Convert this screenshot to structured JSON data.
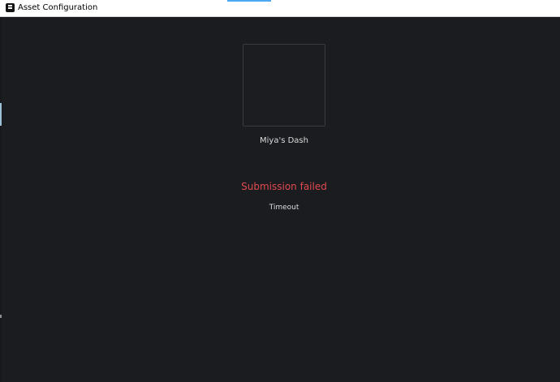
{
  "window": {
    "title": "Asset Configuration",
    "app_icon": "roblox-studio-icon"
  },
  "asset": {
    "name": "Miya's Dash",
    "thumbnail_icon": "empty-thumbnail"
  },
  "status": {
    "title": "Submission failed",
    "detail": "Timeout",
    "error_color": "#e14a4f"
  },
  "theme": {
    "background": "#1b1c20",
    "titlebar": "#ffffff",
    "accent": "#4ea8f4"
  }
}
